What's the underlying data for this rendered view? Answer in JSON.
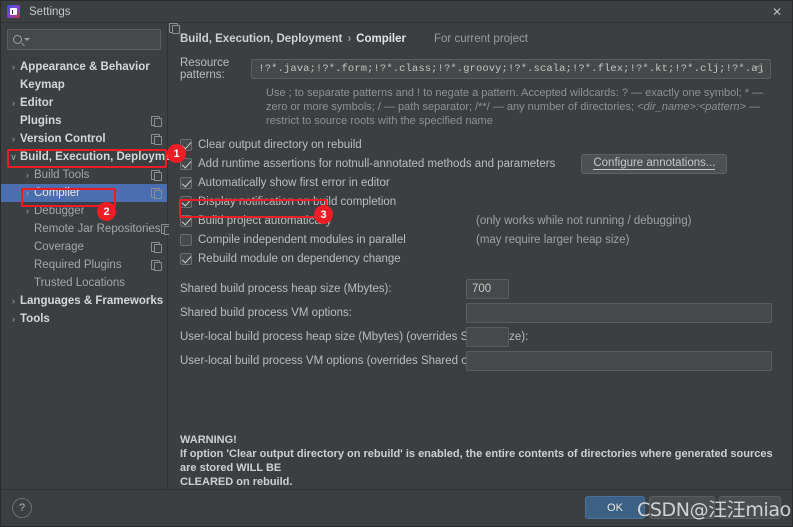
{
  "window": {
    "title": "Settings",
    "icon": "intellij-settings-icon",
    "close_label": "✕"
  },
  "sidebar": {
    "search": {
      "value": "",
      "placeholder": ""
    },
    "items": [
      {
        "label": "Appearance & Behavior",
        "arrow": "›",
        "level": "top",
        "copy": false,
        "selected": false
      },
      {
        "label": "Keymap",
        "arrow": "",
        "level": "top",
        "copy": false,
        "selected": false
      },
      {
        "label": "Editor",
        "arrow": "›",
        "level": "top",
        "copy": false,
        "selected": false
      },
      {
        "label": "Plugins",
        "arrow": "",
        "level": "top",
        "copy": true,
        "selected": false
      },
      {
        "label": "Version Control",
        "arrow": "›",
        "level": "top",
        "copy": true,
        "selected": false
      },
      {
        "label": "Build, Execution, Deployment",
        "arrow": "∨",
        "level": "top",
        "copy": false,
        "selected": false
      },
      {
        "label": "Build Tools",
        "arrow": "›",
        "level": "child",
        "copy": true,
        "selected": false
      },
      {
        "label": "Compiler",
        "arrow": "›",
        "level": "child",
        "copy": true,
        "selected": true
      },
      {
        "label": "Debugger",
        "arrow": "›",
        "level": "child",
        "copy": false,
        "selected": false
      },
      {
        "label": "Remote Jar Repositories",
        "arrow": "",
        "level": "child",
        "copy": true,
        "selected": false
      },
      {
        "label": "Coverage",
        "arrow": "",
        "level": "child",
        "copy": true,
        "selected": false
      },
      {
        "label": "Required Plugins",
        "arrow": "",
        "level": "child",
        "copy": true,
        "selected": false
      },
      {
        "label": "Trusted Locations",
        "arrow": "",
        "level": "child",
        "copy": false,
        "selected": false
      },
      {
        "label": "Languages & Frameworks",
        "arrow": "›",
        "level": "top",
        "copy": false,
        "selected": false
      },
      {
        "label": "Tools",
        "arrow": "›",
        "level": "top",
        "copy": false,
        "selected": false
      }
    ]
  },
  "breadcrumb": {
    "parent": "Build, Execution, Deployment",
    "separator": "›",
    "current": "Compiler",
    "scope": "For current project"
  },
  "resource_patterns": {
    "label": "Resource patterns:",
    "value": "!?*.java;!?*.form;!?*.class;!?*.groovy;!?*.scala;!?*.flex;!?*.kt;!?*.clj;!?*.aj",
    "expand_icon": "⤡",
    "hint_line1": "Use ; to separate patterns and ! to negate a pattern. Accepted wildcards: ? — exactly one symbol; * — zero or more",
    "hint_line2_a": "symbols; / — path separator; /**/ — any number of directories;  ",
    "hint_line2_i": "<dir_name>:<pattern>",
    "hint_line2_b": " — restrict to source roots with",
    "hint_line3": "the specified name"
  },
  "checkboxes": [
    {
      "label": "Clear output directory on rebuild",
      "checked": true,
      "note": ""
    },
    {
      "label": "Add runtime assertions for notnull-annotated methods and parameters",
      "checked": true,
      "note": ""
    },
    {
      "label": "Automatically show first error in editor",
      "checked": true,
      "note": ""
    },
    {
      "label": "Display notification on build completion",
      "checked": true,
      "note": ""
    },
    {
      "label": "Build project automatically",
      "checked": true,
      "note": "(only works while not running / debugging)"
    },
    {
      "label": "Compile independent modules in parallel",
      "checked": false,
      "note": "(may require larger heap size)"
    },
    {
      "label": "Rebuild module on dependency change",
      "checked": true,
      "note": ""
    }
  ],
  "configure_annotations_button": "Configure annotations...",
  "fields": [
    {
      "label": "Shared build process heap size (Mbytes):",
      "value": "700",
      "size": "small"
    },
    {
      "label": "Shared build process VM options:",
      "value": "",
      "size": "wide"
    },
    {
      "label": "User-local build process heap size (Mbytes) (overrides Shared size):",
      "value": "",
      "size": "small"
    },
    {
      "label": "User-local build process VM options (overrides Shared options):",
      "value": "",
      "size": "wide"
    }
  ],
  "warning": {
    "title": "WARNING!",
    "line1": "If option 'Clear output directory on rebuild' is enabled, the entire contents of directories where generated sources are stored WILL BE",
    "line2": "CLEARED on rebuild."
  },
  "footer": {
    "help_label": "?",
    "ok_label": "OK",
    "watermark": "CSDN@汪汪miao~"
  },
  "annotations": [
    {
      "number": "1"
    },
    {
      "number": "2"
    },
    {
      "number": "3"
    }
  ],
  "colors": {
    "accent_blue": "#4b6eaf",
    "ok_blue": "#3d6185",
    "annotation_red": "#ee1c25",
    "panel_bg": "#3c3f41",
    "field_bg": "#45494a"
  }
}
